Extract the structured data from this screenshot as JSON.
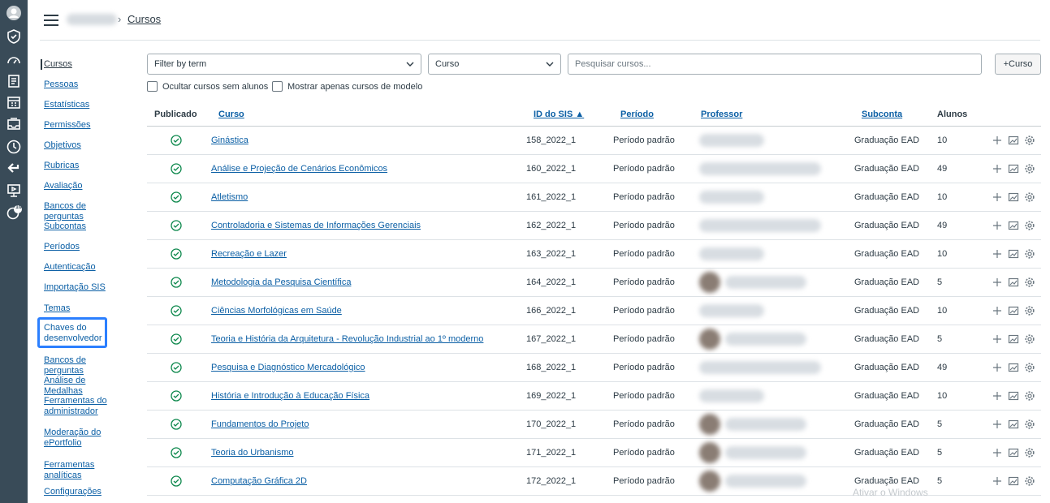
{
  "global_nav": {
    "items": [
      "profile-icon",
      "shield-icon",
      "dashboard-icon",
      "courses-icon",
      "calendar-icon",
      "inbox-icon",
      "history-icon",
      "commons-icon",
      "studio-icon",
      "help-icon"
    ],
    "help_badge": "10",
    "accent": "#394b58"
  },
  "breadcrumb": {
    "current": "Cursos",
    "separator": "›"
  },
  "subnav": {
    "items": [
      {
        "label": "Cursos",
        "active": true
      },
      {
        "label": "Pessoas"
      },
      {
        "label": "Estatísticas"
      },
      {
        "label": "Permissões"
      },
      {
        "label": "Objetivos"
      },
      {
        "label": "Rubricas"
      },
      {
        "label": "Avaliação"
      },
      {
        "label": "Bancos de perguntas"
      },
      {
        "label": "Subcontas"
      },
      {
        "label": "Períodos"
      },
      {
        "label": "Autenticação"
      },
      {
        "label": "Importação SIS"
      },
      {
        "label": "Temas"
      },
      {
        "label": "Chaves do desenvolvedor",
        "focused": true
      },
      {
        "label": "Bancos de perguntas"
      },
      {
        "label": "Análise de Medalhas"
      },
      {
        "label": "Ferramentas do administrador"
      },
      {
        "label": "Moderação do ePortfolio"
      },
      {
        "label": "Ferramentas analíticas"
      },
      {
        "label": "Configurações"
      }
    ]
  },
  "filters": {
    "term_placeholder": "Filter by term",
    "type_value": "Curso",
    "search_placeholder": "Pesquisar cursos...",
    "add_button": "+Curso",
    "hide_empty": "Ocultar cursos sem alunos",
    "blueprint_only": "Mostrar apenas cursos de modelo"
  },
  "table": {
    "headers": {
      "published": "Publicado",
      "course": "Curso",
      "sis_id": "ID do SIS ▲",
      "term": "Período",
      "teacher": "Professor",
      "subaccount": "Subconta",
      "students": "Alunos"
    },
    "rows": [
      {
        "course": "Ginástica",
        "sis": "158_2022_1",
        "term": "Período padrão",
        "sub": "Graduação EAD",
        "students": "10",
        "prof": "short"
      },
      {
        "course": "Análise e Projeção de Cenários Econômicos",
        "sis": "160_2022_1",
        "term": "Período padrão",
        "sub": "Graduação EAD",
        "students": "49",
        "prof": "long"
      },
      {
        "course": "Atletismo",
        "sis": "161_2022_1",
        "term": "Período padrão",
        "sub": "Graduação EAD",
        "students": "10",
        "prof": "short"
      },
      {
        "course": "Controladoria e Sistemas de Informações Gerenciais",
        "sis": "162_2022_1",
        "term": "Período padrão",
        "sub": "Graduação EAD",
        "students": "49",
        "prof": "long"
      },
      {
        "course": "Recreação e Lazer",
        "sis": "163_2022_1",
        "term": "Período padrão",
        "sub": "Graduação EAD",
        "students": "10",
        "prof": "short"
      },
      {
        "course": "Metodologia da Pesquisa Científica",
        "sis": "164_2022_1",
        "term": "Período padrão",
        "sub": "Graduação EAD",
        "students": "5",
        "prof": "avatar"
      },
      {
        "course": "Ciências Morfológicas em Saúde",
        "sis": "166_2022_1",
        "term": "Período padrão",
        "sub": "Graduação EAD",
        "students": "10",
        "prof": "short"
      },
      {
        "course": "Teoria e História da Arquitetura - Revolução Industrial ao 1º moderno",
        "sis": "167_2022_1",
        "term": "Período padrão",
        "sub": "Graduação EAD",
        "students": "5",
        "prof": "avatar"
      },
      {
        "course": "Pesquisa e Diagnóstico Mercadológico",
        "sis": "168_2022_1",
        "term": "Período padrão",
        "sub": "Graduação EAD",
        "students": "49",
        "prof": "long"
      },
      {
        "course": "História e Introdução à Educação Física",
        "sis": "169_2022_1",
        "term": "Período padrão",
        "sub": "Graduação EAD",
        "students": "10",
        "prof": "short"
      },
      {
        "course": "Fundamentos do Projeto",
        "sis": "170_2022_1",
        "term": "Período padrão",
        "sub": "Graduação EAD",
        "students": "5",
        "prof": "avatar"
      },
      {
        "course": "Teoria do Urbanismo",
        "sis": "171_2022_1",
        "term": "Período padrão",
        "sub": "Graduação EAD",
        "students": "5",
        "prof": "avatar"
      },
      {
        "course": "Computação Gráfica 2D",
        "sis": "172_2022_1",
        "term": "Período padrão",
        "sub": "Graduação EAD",
        "students": "5",
        "prof": "avatar"
      }
    ]
  },
  "watermark": "Ativar o Windows"
}
